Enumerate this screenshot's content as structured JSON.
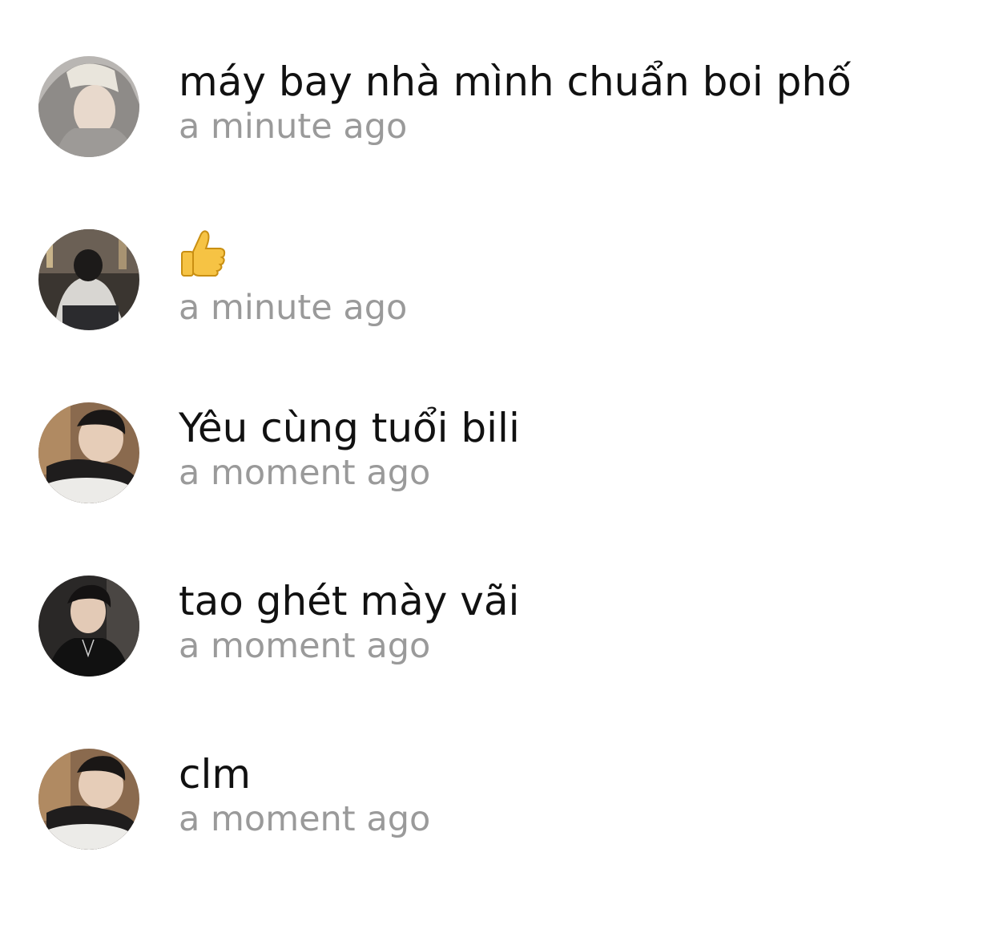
{
  "comments": [
    {
      "message": "máy bay nhà mình chuẩn boi phố",
      "time": "a minute ago"
    },
    {
      "message": "",
      "emoji": "thumbs-up",
      "time": "a minute ago"
    },
    {
      "message": "Yêu cùng tuổi bili",
      "time": "a moment ago"
    },
    {
      "message": "tao ghét mày vãi",
      "time": "a moment ago"
    },
    {
      "message": "clm",
      "time": "a moment ago"
    }
  ]
}
